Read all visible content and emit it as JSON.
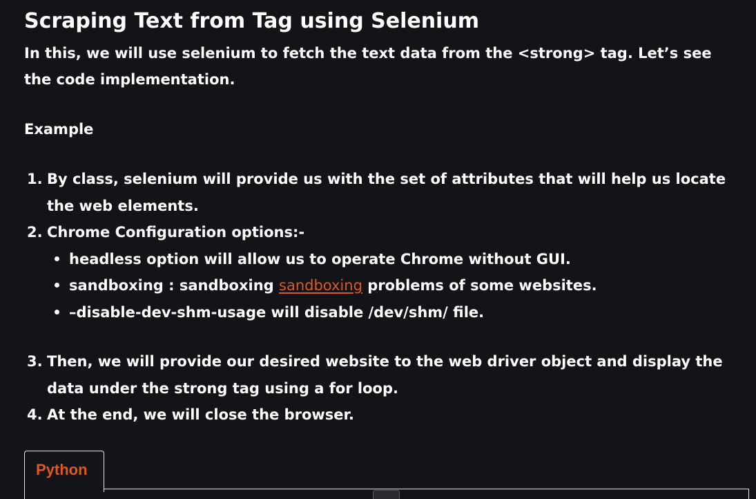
{
  "article": {
    "title": "Scraping Text from Tag using Selenium",
    "intro": "In this, we will use selenium to fetch the text data from the <strong> tag. Let’s see the code implementation.",
    "example_heading": "Example"
  },
  "steps": [
    {
      "number": "1.",
      "text": "By class, selenium will provide us with the set of attributes that will help us locate the web elements."
    },
    {
      "number": "2.",
      "text": "Chrome Configuration options:-",
      "bullets": [
        {
          "text": "headless option will allow us to operate Chrome without GUI."
        },
        {
          "before": "sandboxing : sandboxing ",
          "link": "sandboxing",
          "after": " problems of some websites."
        },
        {
          "text": "–disable-dev-shm-usage will disable /dev/shm/ file."
        }
      ]
    },
    {
      "number": "3.",
      "text": "Then, we will provide our desired website to the web driver object and display the data under the strong tag using a for loop."
    },
    {
      "number": "4.",
      "text": "At the end, we will close the browser."
    }
  ],
  "code_tabs": {
    "active_label": "Python",
    "active_color": "#e2571e"
  },
  "theme": {
    "background": "#131417",
    "text": "#ffffff",
    "link": "#e2571e"
  }
}
